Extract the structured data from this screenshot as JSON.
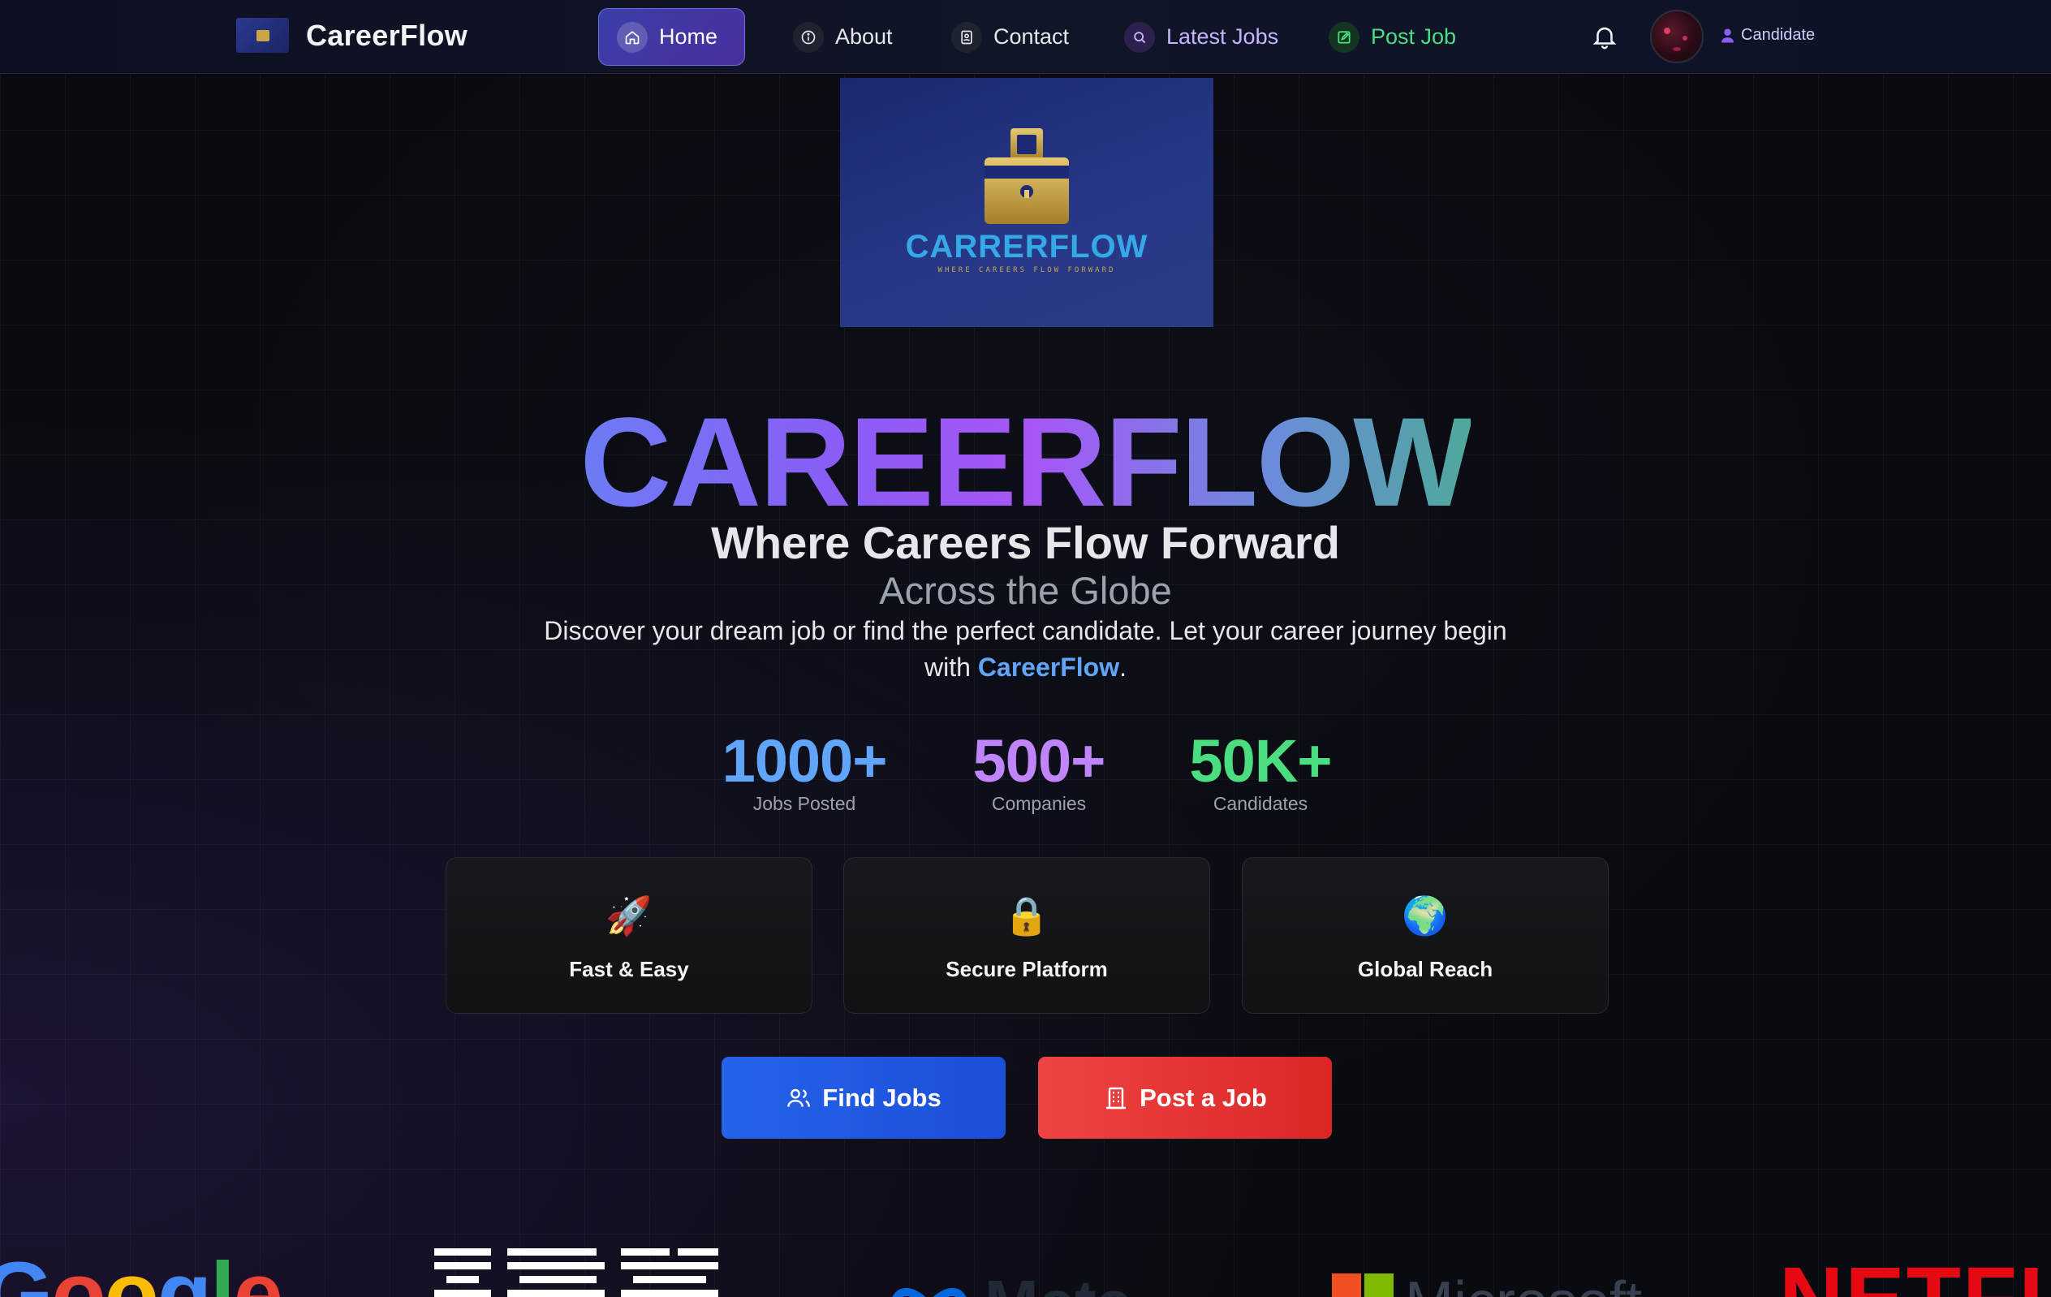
{
  "nav": {
    "brand": "CareerFlow",
    "items": [
      {
        "label": "Home",
        "icon": "home-icon"
      },
      {
        "label": "About",
        "icon": "info-icon"
      },
      {
        "label": "Contact",
        "icon": "contact-card-icon"
      },
      {
        "label": "Latest Jobs",
        "icon": "search-icon"
      },
      {
        "label": "Post Job",
        "icon": "edit-icon"
      }
    ],
    "role": "Candidate",
    "bell_icon": "bell-icon"
  },
  "hero": {
    "logo_name": "CARRERFLOW",
    "logo_tagline": "WHERE CAREERS FLOW FORWARD",
    "title": "CAREERFLOW",
    "subtitle": "Where Careers Flow Forward",
    "subtitle2": "Across the Globe",
    "description_prefix": "Discover your dream job or find the perfect candidate. Let your career journey begin with ",
    "description_highlight": "CareerFlow",
    "description_suffix": "."
  },
  "stats": [
    {
      "value": "1000+",
      "label": "Jobs Posted",
      "color": "#60a5fa"
    },
    {
      "value": "500+",
      "label": "Companies",
      "color": "#c084fc"
    },
    {
      "value": "50K+",
      "label": "Candidates",
      "color": "#4ade80"
    }
  ],
  "features": [
    {
      "emoji": "🚀",
      "label": "Fast & Easy"
    },
    {
      "emoji": "🔒",
      "label": "Secure Platform"
    },
    {
      "emoji": "🌍",
      "label": "Global Reach"
    }
  ],
  "cta": {
    "find_jobs": "Find Jobs",
    "post_job": "Post a Job"
  },
  "companies": {
    "google": "Google",
    "ibm": "IBM",
    "meta": "Meta",
    "microsoft": "Microsoft",
    "netflix": "NETFLIX"
  },
  "colors": {
    "accent_blue": "#2563eb",
    "accent_red": "#ef4444",
    "background": "#0a0b10"
  }
}
